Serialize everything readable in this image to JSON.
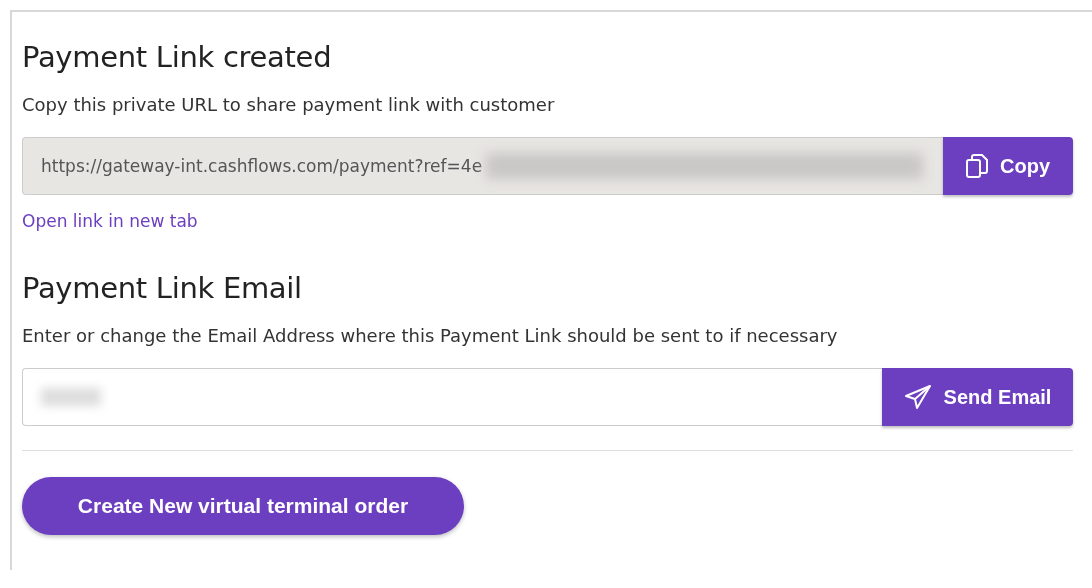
{
  "link_section": {
    "title": "Payment Link created",
    "description": "Copy this private URL to share payment link with customer",
    "url_field": {
      "value": "https://gateway-int.cashflows.com/payment?ref=4e"
    },
    "copy_button": {
      "label": "Copy"
    },
    "open_link": {
      "label": "Open link in new tab"
    }
  },
  "email_section": {
    "title": "Payment Link Email",
    "description": "Enter or change the Email Address where this Payment Link should be sent to if necessary",
    "send_button": {
      "label": "Send Email"
    }
  },
  "create_button": {
    "label": "Create New virtual terminal order"
  }
}
